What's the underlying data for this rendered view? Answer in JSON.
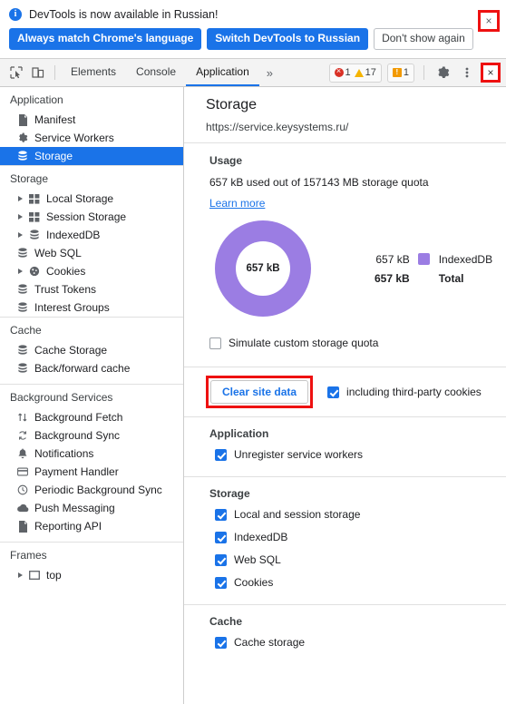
{
  "banner": {
    "icon": "info-icon",
    "message": "DevTools is now available in Russian!",
    "primary_button": "Always match Chrome's language",
    "secondary_button": "Switch DevTools to Russian",
    "tertiary_button": "Don't show again",
    "close_label": "×"
  },
  "toolbar": {
    "inspect_icon": "inspect-element-icon",
    "device_icon": "device-toolbar-icon",
    "tabs": [
      {
        "label": "Elements",
        "active": false
      },
      {
        "label": "Console",
        "active": false
      },
      {
        "label": "Application",
        "active": true
      }
    ],
    "more_tabs": "»",
    "errors": "1",
    "warnings": "17",
    "messages": "1",
    "settings_icon": "gear-icon",
    "menu_icon": "more-vertical-icon",
    "close_label": "×",
    "accent": "#1a73e8",
    "error_color": "#d93025",
    "warning_color": "#f5b400",
    "message_color": "#f29900"
  },
  "sidebar": {
    "groups": [
      {
        "title": "Application",
        "items": [
          {
            "label": "Manifest",
            "icon": "document-icon",
            "arrow": false,
            "selected": false
          },
          {
            "label": "Service Workers",
            "icon": "gear-icon",
            "arrow": false,
            "selected": false
          },
          {
            "label": "Storage",
            "icon": "database-icon",
            "arrow": false,
            "selected": true
          }
        ]
      },
      {
        "title": "Storage",
        "items": [
          {
            "label": "Local Storage",
            "icon": "table-icon",
            "arrow": true,
            "selected": false
          },
          {
            "label": "Session Storage",
            "icon": "table-icon",
            "arrow": true,
            "selected": false
          },
          {
            "label": "IndexedDB",
            "icon": "database-icon",
            "arrow": true,
            "selected": false
          },
          {
            "label": "Web SQL",
            "icon": "database-icon",
            "arrow": false,
            "selected": false
          },
          {
            "label": "Cookies",
            "icon": "cookie-icon",
            "arrow": true,
            "selected": false
          },
          {
            "label": "Trust Tokens",
            "icon": "database-icon",
            "arrow": false,
            "selected": false
          },
          {
            "label": "Interest Groups",
            "icon": "database-icon",
            "arrow": false,
            "selected": false
          }
        ]
      },
      {
        "title": "Cache",
        "items": [
          {
            "label": "Cache Storage",
            "icon": "database-icon",
            "arrow": false,
            "selected": false
          },
          {
            "label": "Back/forward cache",
            "icon": "database-icon",
            "arrow": false,
            "selected": false
          }
        ]
      },
      {
        "title": "Background Services",
        "items": [
          {
            "label": "Background Fetch",
            "icon": "arrows-updown-icon",
            "arrow": false,
            "selected": false
          },
          {
            "label": "Background Sync",
            "icon": "sync-icon",
            "arrow": false,
            "selected": false
          },
          {
            "label": "Notifications",
            "icon": "bell-icon",
            "arrow": false,
            "selected": false
          },
          {
            "label": "Payment Handler",
            "icon": "credit-card-icon",
            "arrow": false,
            "selected": false
          },
          {
            "label": "Periodic Background Sync",
            "icon": "clock-icon",
            "arrow": false,
            "selected": false
          },
          {
            "label": "Push Messaging",
            "icon": "cloud-icon",
            "arrow": false,
            "selected": false
          },
          {
            "label": "Reporting API",
            "icon": "document-icon",
            "arrow": false,
            "selected": false
          }
        ]
      },
      {
        "title": "Frames",
        "items": [
          {
            "label": "top",
            "icon": "frame-icon",
            "arrow": true,
            "selected": false
          }
        ]
      }
    ]
  },
  "main": {
    "title": "Storage",
    "origin": "https://service.keysystems.ru/",
    "usage": {
      "heading": "Usage",
      "text": "657 kB used out of 157143 MB storage quota",
      "learn_more": "Learn more",
      "simulate_label": "Simulate custom storage quota",
      "simulate_checked": false
    },
    "clear": {
      "button_label": "Clear site data",
      "third_party_label": "including third-party cookies",
      "third_party_checked": true
    },
    "sections": [
      {
        "title": "Application",
        "items": [
          {
            "label": "Unregister service workers",
            "checked": true
          }
        ]
      },
      {
        "title": "Storage",
        "items": [
          {
            "label": "Local and session storage",
            "checked": true
          },
          {
            "label": "IndexedDB",
            "checked": true
          },
          {
            "label": "Web SQL",
            "checked": true
          },
          {
            "label": "Cookies",
            "checked": true
          }
        ]
      },
      {
        "title": "Cache",
        "items": [
          {
            "label": "Cache storage",
            "checked": true
          }
        ]
      }
    ]
  },
  "chart_data": {
    "type": "pie",
    "title": "Storage usage breakdown",
    "center_label": "657 kB",
    "legend_position": "right",
    "categories": [
      "IndexedDB"
    ],
    "values": [
      657
    ],
    "value_labels": [
      "657 kB"
    ],
    "colors": [
      "#9b7de3"
    ],
    "total_label": "Total",
    "total_value_label": "657 kB",
    "total_value": 657,
    "unit": "kB",
    "quota_text": "657 kB used out of 157143 MB storage quota"
  }
}
